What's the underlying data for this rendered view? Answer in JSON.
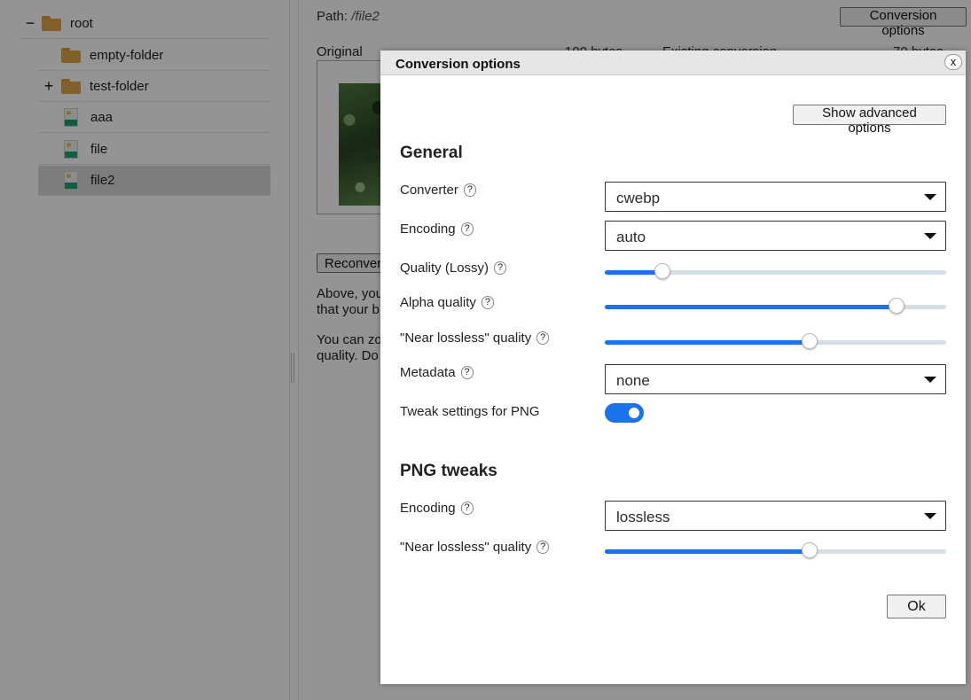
{
  "sidebar": {
    "items": [
      {
        "label": "root",
        "toggle": "−",
        "icon": "folder-icon",
        "selected": false
      },
      {
        "label": "empty-folder",
        "toggle": "",
        "icon": "folder-icon",
        "selected": false
      },
      {
        "label": "test-folder",
        "toggle": "+",
        "icon": "folder-icon",
        "selected": false
      },
      {
        "label": "aaa",
        "toggle": "",
        "icon": "image-file-icon",
        "selected": false
      },
      {
        "label": "file",
        "toggle": "",
        "icon": "image-file-icon",
        "selected": false
      },
      {
        "label": "file2",
        "toggle": "",
        "icon": "image-file-icon",
        "selected": true
      }
    ]
  },
  "main": {
    "path_label": "Path:",
    "path_value": "/file2",
    "conversion_options_button": "Conversion options",
    "original_label": "Original",
    "original_size": "100 bytes",
    "existing_label": "Existing conversion",
    "converted_size": "70 bytes",
    "reconvert_button": "Reconvert",
    "para1_line1": "Above, you",
    "para1_line2": "that your b",
    "para2_line1": "You can zo",
    "para2_line2": "quality. Do"
  },
  "dialog": {
    "title": "Conversion options",
    "close_label": "x",
    "advanced_button": "Show advanced options",
    "general_heading": "General",
    "help_glyph": "?",
    "converter": {
      "label": "Converter",
      "value": "cwebp"
    },
    "encoding": {
      "label": "Encoding",
      "value": "auto"
    },
    "quality": {
      "label": "Quality (Lossy)",
      "level": 0.17
    },
    "alpha_quality": {
      "label": "Alpha quality",
      "level": 0.855
    },
    "near_lossless": {
      "label": "\"Near lossless\" quality",
      "level": 0.6
    },
    "metadata": {
      "label": "Metadata",
      "value": "none"
    },
    "tweak_png": {
      "label": "Tweak settings for PNG",
      "on": true
    },
    "png_heading": "PNG tweaks",
    "png_encoding": {
      "label": "Encoding",
      "value": "lossless"
    },
    "png_near_lossless": {
      "label": "\"Near lossless\" quality",
      "level": 0.6
    },
    "ok_button": "Ok"
  },
  "colors": {
    "accent": "#1a73e8",
    "overlay": "rgba(0,0,0,0.42)"
  }
}
